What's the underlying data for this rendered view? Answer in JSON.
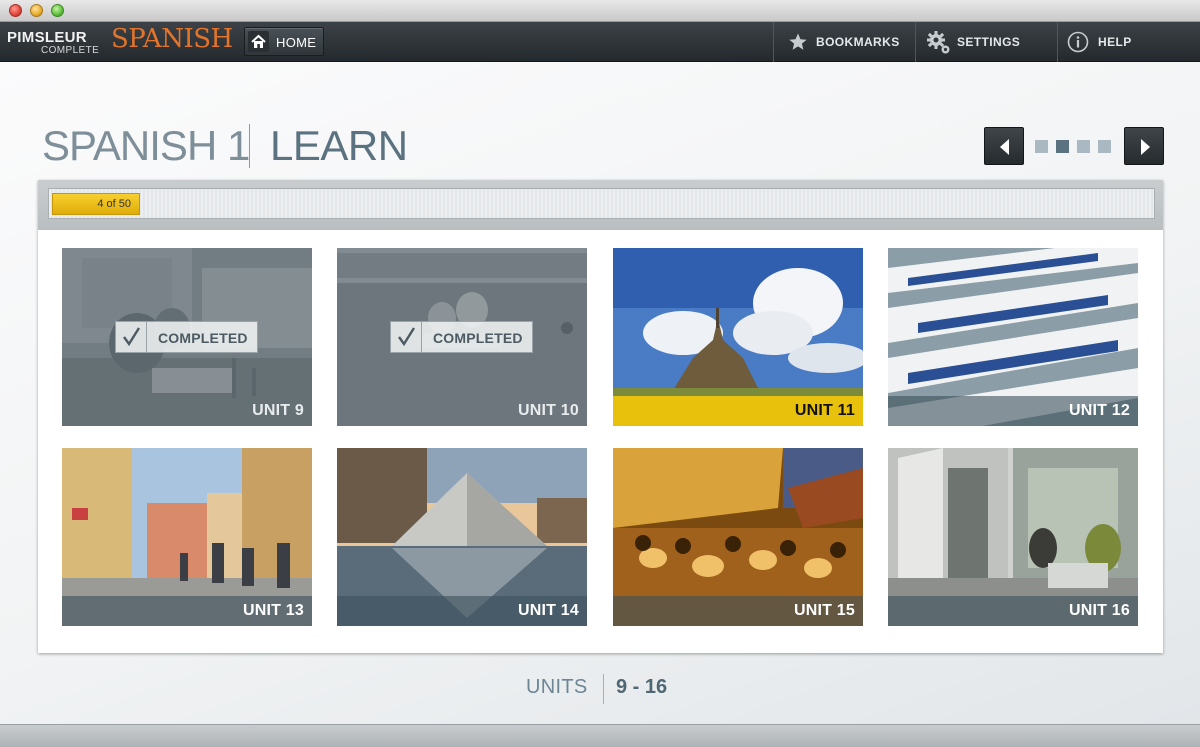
{
  "header": {
    "logo_brand": "PIMSLEUR",
    "logo_edition": "COMPLETE",
    "logo_language": "SPANISH",
    "home_label": "HOME",
    "nav": [
      {
        "label": "BOOKMARKS",
        "icon": "star-icon"
      },
      {
        "label": "SETTINGS",
        "icon": "gear-icon"
      },
      {
        "label": "HELP",
        "icon": "info-icon"
      }
    ]
  },
  "page": {
    "title_course": "SPANISH 1",
    "title_mode": "LEARN",
    "pager": {
      "pages": 4,
      "current_page": 2
    }
  },
  "progress": {
    "label": "4 of 50",
    "completed": 4,
    "total": 50
  },
  "units": [
    {
      "label": "UNIT 9",
      "status": "completed",
      "badge": "COMPLETED"
    },
    {
      "label": "UNIT 10",
      "status": "completed",
      "badge": "COMPLETED"
    },
    {
      "label": "UNIT 11",
      "status": "current"
    },
    {
      "label": "UNIT 12",
      "status": "locked"
    },
    {
      "label": "UNIT 13",
      "status": "locked"
    },
    {
      "label": "UNIT 14",
      "status": "locked"
    },
    {
      "label": "UNIT 15",
      "status": "locked"
    },
    {
      "label": "UNIT 16",
      "status": "locked"
    }
  ],
  "footer": {
    "units_label": "UNITS",
    "range": "9 - 16"
  },
  "colors": {
    "accent_orange": "#e3742a",
    "progress_yellow": "#f0c21a",
    "header_dark": "#2c3236",
    "title_slate": "#5b7280",
    "dot_active": "#5b7280",
    "dot_inactive": "#a9b8c1"
  }
}
